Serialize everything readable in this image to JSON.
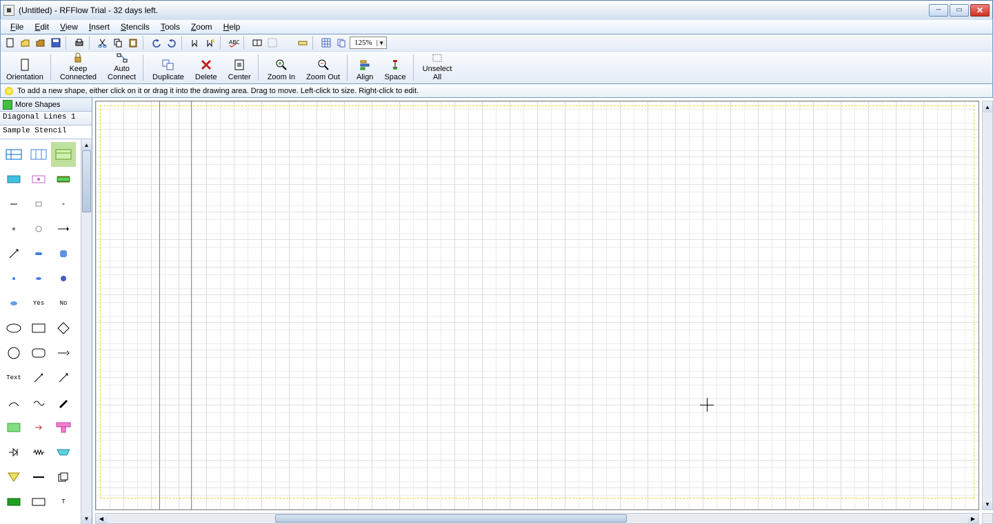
{
  "titlebar": {
    "title": "(Untitled) - RFFlow Trial - 32 days left."
  },
  "menu": {
    "file": "File",
    "edit": "Edit",
    "view": "View",
    "insert": "Insert",
    "stencils": "Stencils",
    "tools": "Tools",
    "zoom": "Zoom",
    "help": "Help"
  },
  "zoom_value": "125%",
  "bigbuttons": {
    "orientation1": "Orientation",
    "keep": "Keep",
    "connected": "Connected",
    "auto": "Auto",
    "connect": "Connect",
    "duplicate": "Duplicate",
    "delete": "Delete",
    "center": "Center",
    "zoomin": "Zoom In",
    "zoomout": "Zoom Out",
    "align": "Align",
    "space": "Space",
    "unselect": "Unselect",
    "all": "All"
  },
  "tip": "To add a new shape, either click on it or drag it into the drawing area. Drag to move. Left-click to size. Right-click to edit.",
  "sidebar": {
    "more_shapes": "More Shapes",
    "stencil1": "Diagonal Lines 1",
    "stencil2": "Sample Stencil",
    "shape_labels": {
      "yes": "Yes",
      "no": "No",
      "text": "Text",
      "t": "T"
    }
  }
}
